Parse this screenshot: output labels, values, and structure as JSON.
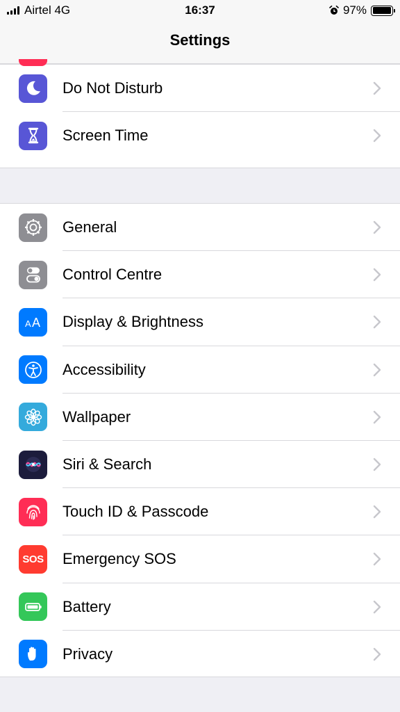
{
  "status_bar": {
    "carrier": "Airtel 4G",
    "time": "16:37",
    "battery_percent": "97%",
    "battery_level": 0.97
  },
  "nav": {
    "title": "Settings"
  },
  "group1": [
    {
      "label": "Do Not Disturb",
      "icon": "moon-icon",
      "color": "#5856d6"
    },
    {
      "label": "Screen Time",
      "icon": "hourglass-icon",
      "color": "#5856d6"
    }
  ],
  "group2": [
    {
      "label": "General",
      "icon": "gear-icon",
      "color": "#8e8e93"
    },
    {
      "label": "Control Centre",
      "icon": "toggles-icon",
      "color": "#8e8e93"
    },
    {
      "label": "Display & Brightness",
      "icon": "text-size-icon",
      "color": "#007aff"
    },
    {
      "label": "Accessibility",
      "icon": "accessibility-icon",
      "color": "#007aff"
    },
    {
      "label": "Wallpaper",
      "icon": "flower-icon",
      "color": "#34aadc"
    },
    {
      "label": "Siri & Search",
      "icon": "siri-icon",
      "color": "#1c1c3c"
    },
    {
      "label": "Touch ID & Passcode",
      "icon": "fingerprint-icon",
      "color": "#ff2d55"
    },
    {
      "label": "Emergency SOS",
      "icon": "sos-icon",
      "color": "#ff3b30",
      "icon_text": "SOS"
    },
    {
      "label": "Battery",
      "icon": "battery-icon",
      "color": "#34c759"
    },
    {
      "label": "Privacy",
      "icon": "hand-icon",
      "color": "#007aff"
    }
  ]
}
